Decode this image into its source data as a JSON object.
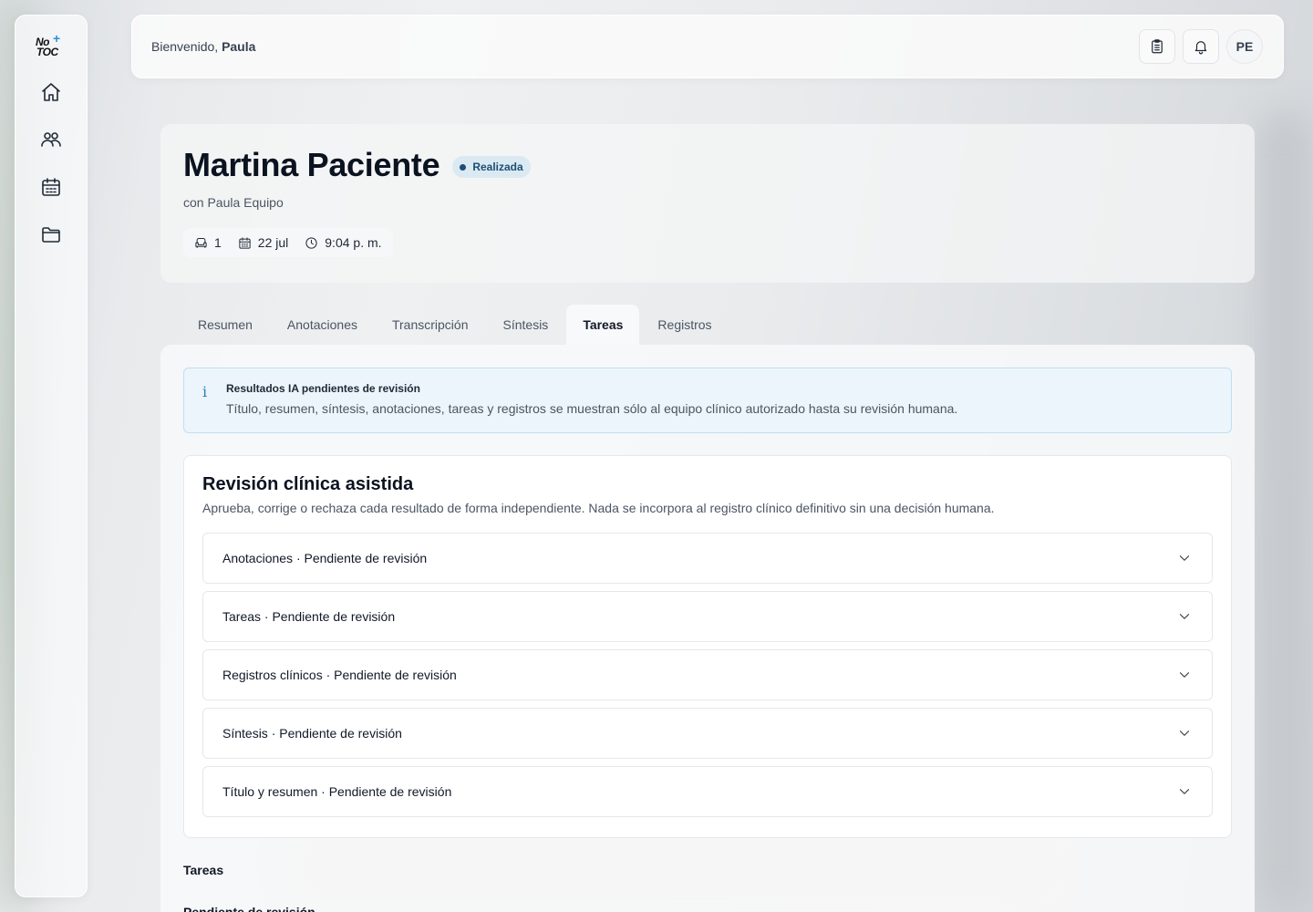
{
  "app": {
    "logo_line1": "No",
    "logo_line2": "TOC",
    "logo_plus": "+"
  },
  "sidebar": {
    "items": [
      {
        "name": "home",
        "icon": "home-icon"
      },
      {
        "name": "patients",
        "icon": "users-icon"
      },
      {
        "name": "calendar",
        "icon": "calendar-icon"
      },
      {
        "name": "folder",
        "icon": "folder-icon"
      }
    ]
  },
  "header": {
    "welcome_prefix": "Bienvenido,",
    "user_name": "Paula",
    "avatar_initials": "PE"
  },
  "patient": {
    "name": "Martina Paciente",
    "status": "Realizada",
    "subtitle": "con Paula Equipo",
    "session_number": "1",
    "date": "22 jul",
    "time": "9:04 p. m."
  },
  "tabs": [
    {
      "label": "Resumen",
      "active": false
    },
    {
      "label": "Anotaciones",
      "active": false
    },
    {
      "label": "Transcripción",
      "active": false
    },
    {
      "label": "Síntesis",
      "active": false
    },
    {
      "label": "Tareas",
      "active": true
    },
    {
      "label": "Registros",
      "active": false
    }
  ],
  "info": {
    "icon": "i",
    "title": "Resultados IA pendientes de revisión",
    "text": "Título, resumen, síntesis, anotaciones, tareas y registros se muestran sólo al equipo clínico autorizado hasta su revisión humana."
  },
  "review": {
    "title": "Revisión clínica asistida",
    "description": "Aprueba, corrige o rechaza cada resultado de forma independiente. Nada se incorpora al registro clínico definitivo sin una decisión humana.",
    "items": [
      "Anotaciones · Pendiente de revisión",
      "Tareas · Pendiente de revisión",
      "Registros clínicos · Pendiente de revisión",
      "Síntesis · Pendiente de revisión",
      "Título y resumen · Pendiente de revisión"
    ]
  },
  "tasks_section": {
    "title": "Tareas",
    "partial_text": "Pendiente de revisión"
  },
  "colors": {
    "accent": "#2b7fb7",
    "status_badge_bg": "#dbe9f2",
    "status_badge_text": "#1d4e73",
    "info_bg": "#ecf5fb",
    "info_border": "#bfe0f2"
  }
}
